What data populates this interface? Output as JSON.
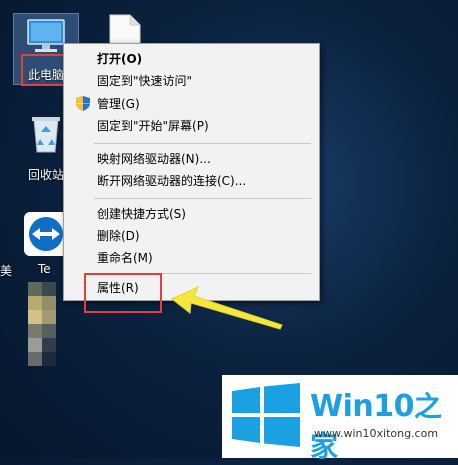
{
  "desktop": {
    "icons": [
      {
        "label": "此电脑"
      },
      {
        "label": "回收站"
      },
      {
        "label": "Te"
      },
      {
        "label": "美"
      }
    ]
  },
  "context_menu": {
    "items": [
      {
        "label": "打开(O)",
        "bold": true
      },
      {
        "label": "固定到\"快速访问\""
      },
      {
        "label": "管理(G)",
        "icon": "shield-icon"
      },
      {
        "label": "固定到\"开始\"屏幕(P)"
      },
      {
        "label": "映射网络驱动器(N)..."
      },
      {
        "label": "断开网络驱动器的连接(C)..."
      },
      {
        "label": "创建快捷方式(S)"
      },
      {
        "label": "删除(D)"
      },
      {
        "label": "重命名(M)"
      },
      {
        "label": "属性(R)"
      }
    ]
  },
  "watermark": {
    "title": "Win10",
    "title_zh": "之家",
    "url": "www.win10xitong.com"
  },
  "colors": {
    "highlight": "#e0413d",
    "arrow": "#f5e73b",
    "brand": "#1ba1e2"
  }
}
